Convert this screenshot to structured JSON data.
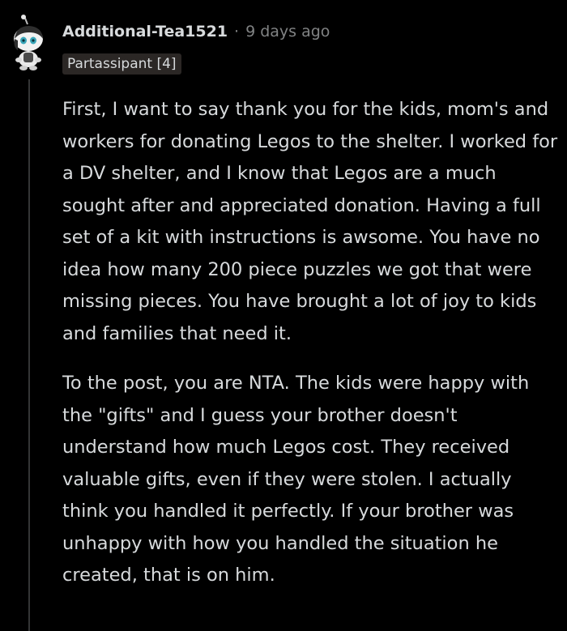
{
  "comment": {
    "username": "Additional-Tea1521",
    "separator": "·",
    "timestamp": "9 days ago",
    "flair": "Partassipant [4]",
    "paragraphs": [
      "First, I want to say thank you for the kids, mom's and workers for donating Legos to the shelter. I worked for a DV shelter, and I know that Legos are a much sought after and appreciated donation. Having a full set of a kit with instructions is awsome. You have no idea how many 200 piece puzzles we got that were missing pieces. You have brought a lot of joy to kids and families that need it.",
      "To the post, you are NTA. The kids were happy with the \"gifts\" and I guess your brother doesn't understand how much Legos cost. They received valuable gifts, even if they were stolen. I actually think you handled it perfectly. If your brother was unhappy with how you handled the situation he created, that is on him."
    ]
  },
  "colors": {
    "background": "#000000",
    "text": "#d7dadc",
    "meta": "#818384",
    "flair_bg": "#2b2725",
    "thread_line": "#343536"
  },
  "icons": {
    "avatar": "snoo-avatar-icon"
  }
}
